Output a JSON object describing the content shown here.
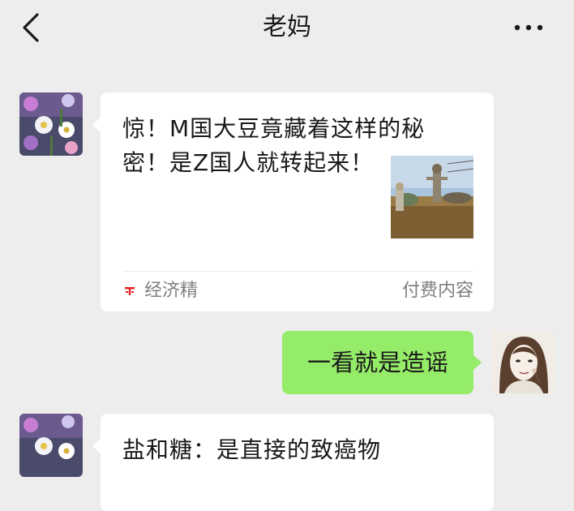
{
  "header": {
    "title": "老妈",
    "back_icon": "chevron-left-icon",
    "more_icon": "more-dots-icon"
  },
  "messages": [
    {
      "sender": "mom",
      "type": "article",
      "title": "惊！M国大豆竟藏着这样的秘密！是Z国人就转起来！",
      "source": "经济精",
      "source_icon": "publisher-logo-icon",
      "badge": "付费内容"
    },
    {
      "sender": "me",
      "type": "text",
      "text": "一看就是造谣"
    },
    {
      "sender": "mom",
      "type": "article",
      "title": "盐和糖：是直接的致癌物"
    }
  ],
  "colors": {
    "background": "#ededed",
    "my_bubble": "#95ec69",
    "card": "#ffffff",
    "secondary_text": "#7f7f7f",
    "publisher_logo": "#e02020"
  }
}
